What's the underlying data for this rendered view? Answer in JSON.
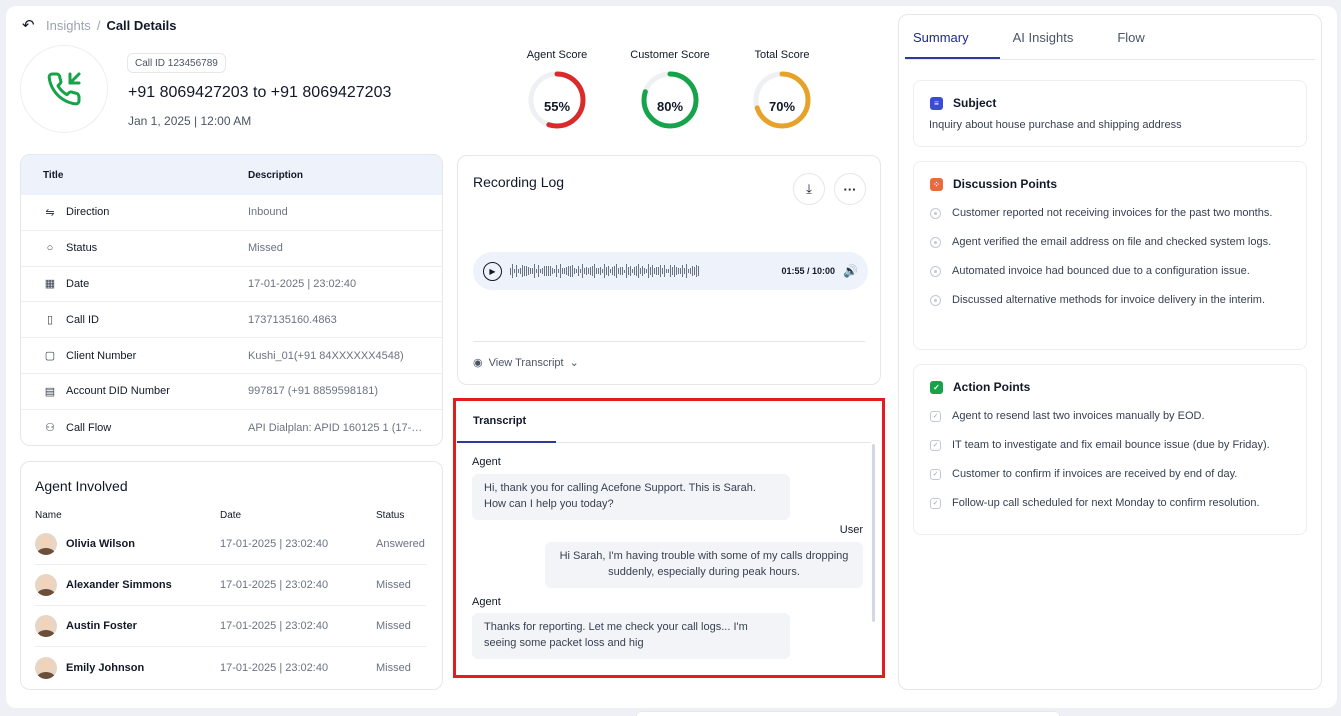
{
  "breadcrumb": {
    "parent": "Insights",
    "separator": "/",
    "current": "Call Details"
  },
  "call": {
    "id_chip": "Call ID 123456789",
    "title": "+91 8069427203 to +91 8069427203",
    "datetime": "Jan 1, 2025 | 12:00 AM",
    "icon": "incoming-call-icon"
  },
  "scores": [
    {
      "label": "Agent Score",
      "value": "55%",
      "percent": 55,
      "color": "#d92b2b"
    },
    {
      "label": "Customer Score",
      "value": "80%",
      "percent": 80,
      "color": "#16a34a"
    },
    {
      "label": "Total Score",
      "value": "70%",
      "percent": 70,
      "color": "#e6a229"
    }
  ],
  "details": {
    "header": {
      "title": "Title",
      "description": "Description"
    },
    "rows": [
      {
        "icon": "arrows-exchange-icon",
        "label": "Direction",
        "value": "Inbound"
      },
      {
        "icon": "refresh-icon",
        "label": "Status",
        "value": "Missed"
      },
      {
        "icon": "calendar-icon",
        "label": "Date",
        "value": "17-01-2025 | 23:02:40"
      },
      {
        "icon": "id-icon",
        "label": "Call ID",
        "value": "1737135160.4863"
      },
      {
        "icon": "phone-icon",
        "label": "Client Number",
        "value": "Kushi_01(+91 84XXXXXX4548)"
      },
      {
        "icon": "card-icon",
        "label": "Account DID Number",
        "value": "997817 (+91 8859598181)"
      },
      {
        "icon": "flow-icon",
        "label": "Call Flow",
        "value": "API Dialplan: APID 160125 1 (17-01..."
      }
    ]
  },
  "agents": {
    "title": "Agent Involved",
    "columns": [
      "Name",
      "Date",
      "Status"
    ],
    "rows": [
      {
        "name": "Olivia Wilson",
        "date": "17-01-2025 | 23:02:40",
        "status": "Answered"
      },
      {
        "name": "Alexander Simmons",
        "date": "17-01-2025 | 23:02:40",
        "status": "Missed"
      },
      {
        "name": "Austin Foster",
        "date": "17-01-2025 | 23:02:40",
        "status": "Missed"
      },
      {
        "name": "Emily Johnson",
        "date": "17-01-2025 | 23:02:40",
        "status": "Missed"
      }
    ]
  },
  "recording": {
    "title": "Recording Log",
    "download_icon": "download-icon",
    "more_icon": "more-horizontal-icon",
    "time": "01:55 / 10:00",
    "view_transcript": "View Transcript"
  },
  "transcript": {
    "tab": "Transcript",
    "messages": [
      {
        "speaker": "Agent",
        "text": "Hi, thank you for calling Acefone Support. This is Sarah. How can I help you today?"
      },
      {
        "speaker": "User",
        "text": "Hi Sarah, I'm having trouble with some of my calls dropping suddenly, especially during peak hours."
      },
      {
        "speaker": "Agent",
        "text": "Thanks for reporting. Let me check your call logs... I'm seeing some packet loss and hig"
      }
    ]
  },
  "right_panel": {
    "tabs": [
      "Summary",
      "AI Insights",
      "Flow"
    ],
    "active_tab": "Summary",
    "subject": {
      "title": "Subject",
      "text": "Inquiry about house purchase and shipping address",
      "color": "#3b4bd8"
    },
    "discussion": {
      "title": "Discussion Points",
      "color": "#ea6a3c",
      "points": [
        "Customer reported not receiving invoices for the past two months.",
        "Agent verified the email address on file and checked system logs.",
        "Automated invoice had bounced due to a configuration issue.",
        "Discussed alternative methods for invoice delivery in the interim."
      ]
    },
    "actions": {
      "title": "Action Points",
      "color": "#16a34a",
      "points": [
        "Agent to resend last two invoices manually by EOD.",
        " IT team to investigate and fix email bounce issue (due by Friday).",
        "Customer to confirm if invoices are received by end of day.",
        "Follow-up call scheduled for next Monday to confirm resolution."
      ]
    }
  }
}
